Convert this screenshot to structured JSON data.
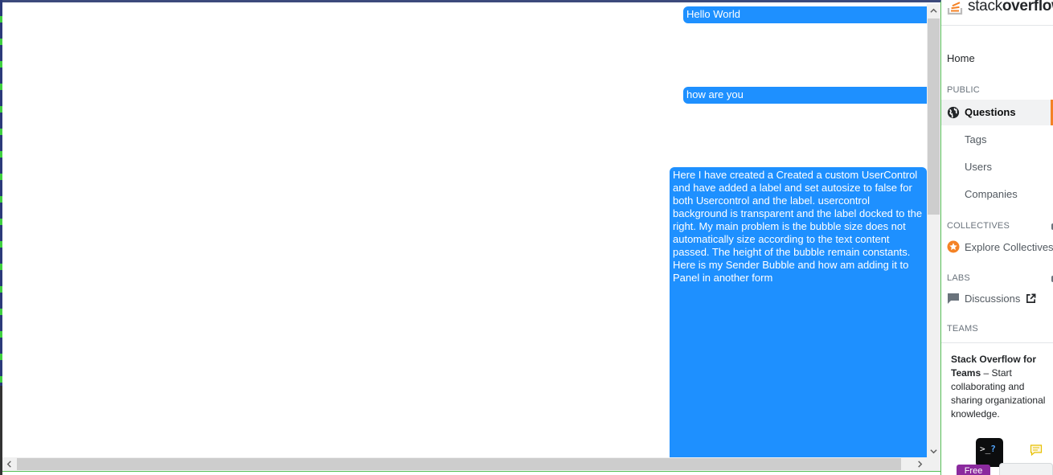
{
  "chat": {
    "messages": [
      {
        "text": "Hello World"
      },
      {
        "text": "how are you"
      },
      {
        "text": "Here I have created a Created a custom UserControl and have added a label and set autosize to false for both Usercontrol and the label. usercontrol background is transparent and the label docked to the right. My main problem is the bubble size does not automatically size according to the text content passed. The height of the bubble remain constants. Here is my Sender Bubble and how am adding it to Panel in another form"
      }
    ],
    "bubble_color": "#1e90ff"
  },
  "sidebar": {
    "logo_light": "stack",
    "logo_bold": "overflow",
    "home": "Home",
    "public_label": "PUBLIC",
    "questions": "Questions",
    "tags": "Tags",
    "users": "Users",
    "companies": "Companies",
    "collectives_label": "COLLECTIVES",
    "explore_collectives": "Explore Collectives",
    "labs_label": "LABS",
    "discussions": "Discussions",
    "teams_label": "TEAMS",
    "teams_title": "Stack Overflow for Teams",
    "teams_desc": " – Start collaborating and sharing organizational knowledge.",
    "terminal_prompt": ">_",
    "terminal_q": "?",
    "free_badge": "Free",
    "accent_color": "#f48225"
  }
}
